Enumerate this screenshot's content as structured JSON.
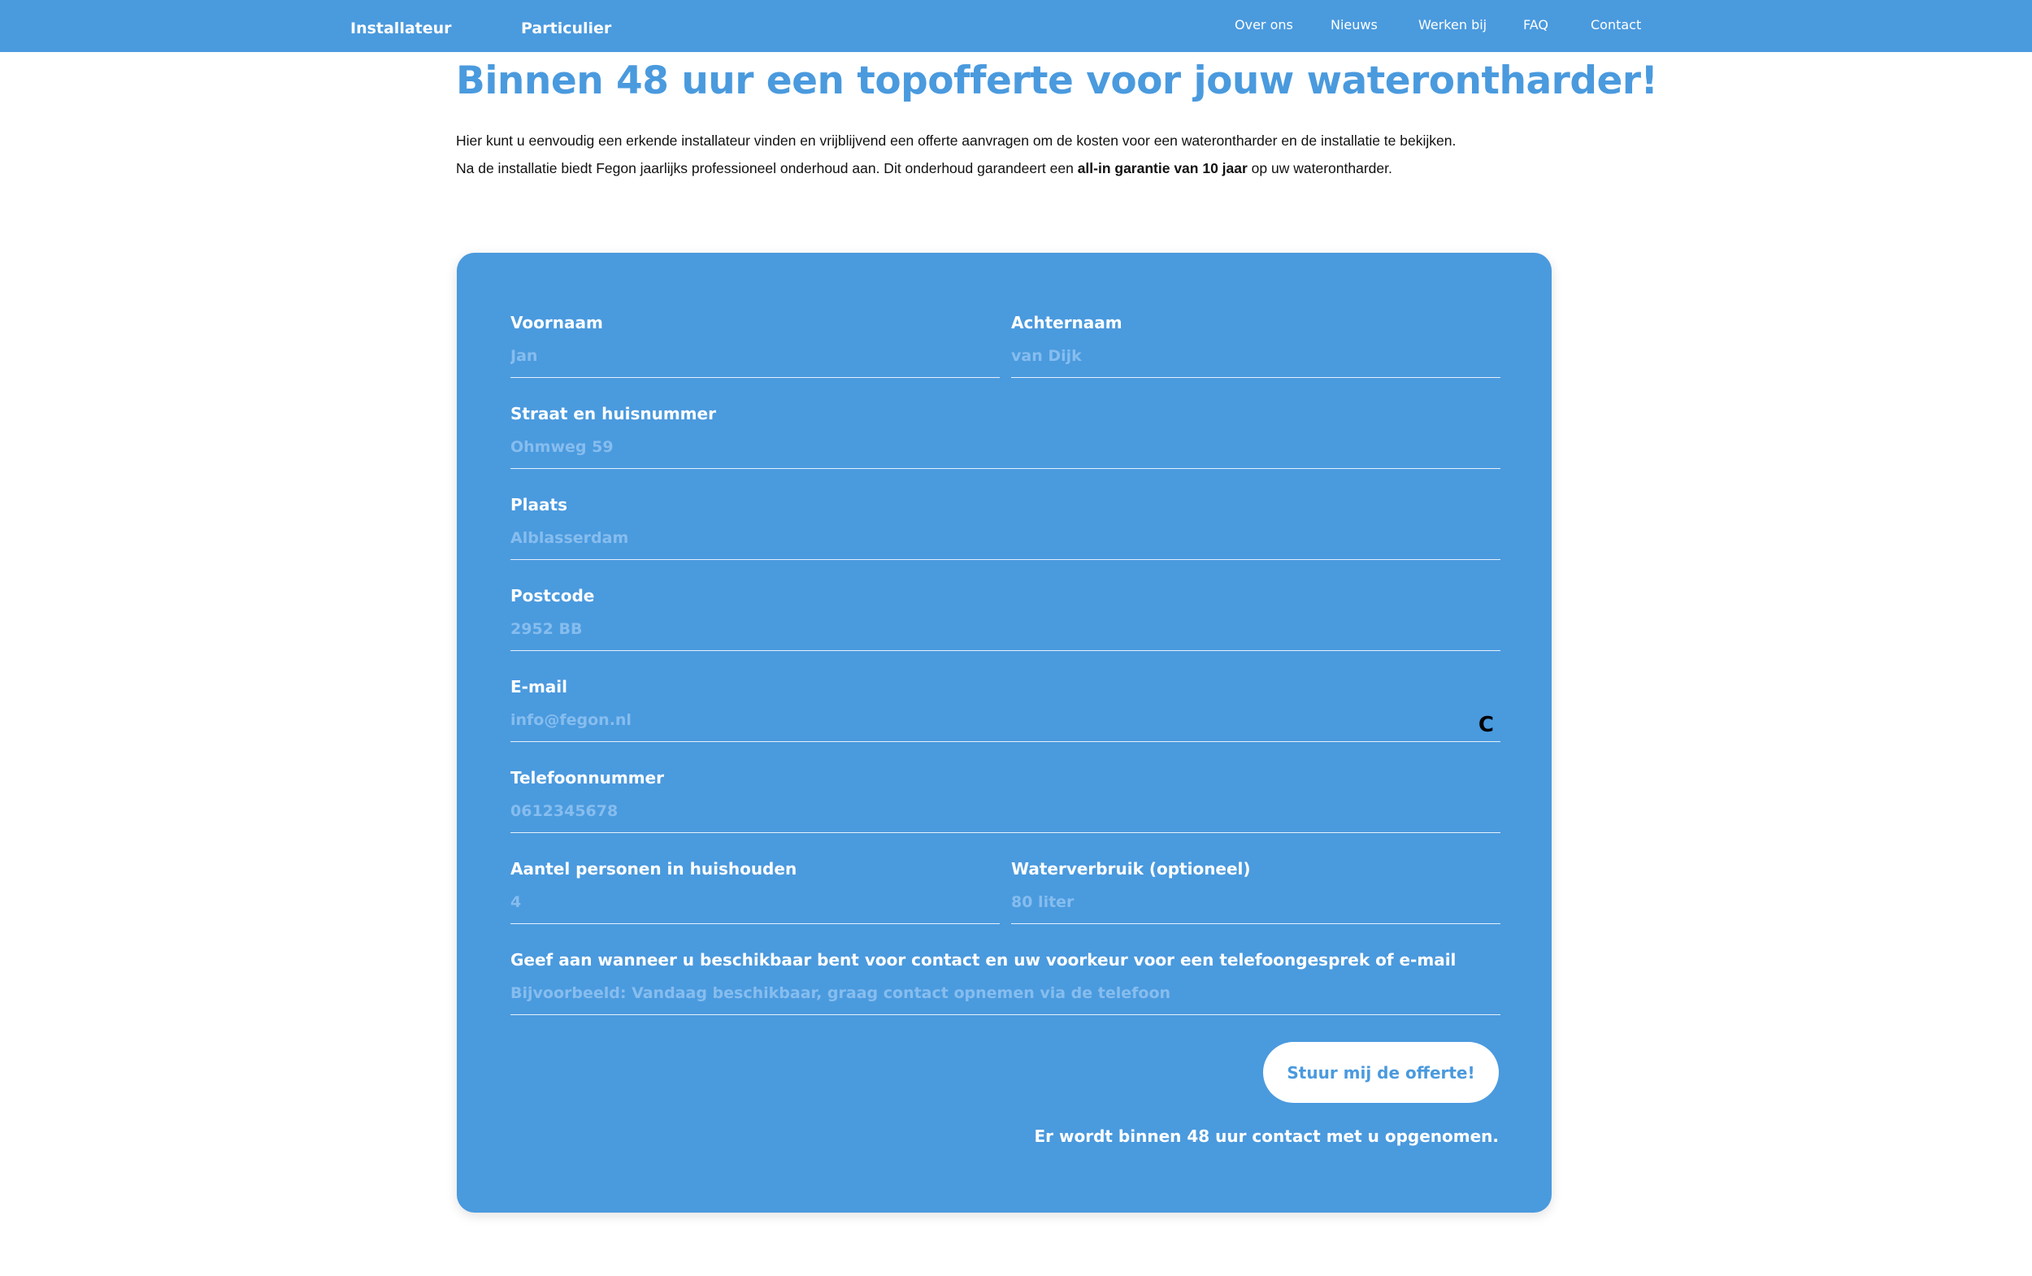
{
  "nav": {
    "left": [
      "Installateur",
      "Particulier"
    ],
    "right": [
      "Over ons",
      "Nieuws",
      "Werken bij",
      "FAQ",
      "Contact"
    ]
  },
  "hero": {
    "title": "Binnen 48 uur een topofferte voor jouw waterontharder!",
    "line1": "Hier kunt u eenvoudig een erkende installateur vinden en vrijblijvend een offerte aanvragen om de kosten voor een waterontharder en de installatie te bekijken.",
    "line2_before": "Na de installatie biedt Fegon jaarlijks professioneel onderhoud aan. Dit onderhoud garandeert een ",
    "line2_bold": "all-in garantie van 10 jaar",
    "line2_after": " op uw waterontharder."
  },
  "form": {
    "voornaam": {
      "label": "Voornaam",
      "placeholder": "Jan"
    },
    "achternaam": {
      "label": "Achternaam",
      "placeholder": "van Dijk"
    },
    "straat": {
      "label": "Straat en huisnummer",
      "placeholder": "Ohmweg 59"
    },
    "plaats": {
      "label": "Plaats",
      "placeholder": "Alblasserdam"
    },
    "postcode": {
      "label": "Postcode",
      "placeholder": "2952 BB"
    },
    "email": {
      "label": "E-mail",
      "placeholder": "info@fegon.nl",
      "loader_glyph": "C"
    },
    "telefoon": {
      "label": "Telefoonnummer",
      "placeholder": "0612345678"
    },
    "personen": {
      "label": "Aantel personen in huishouden",
      "placeholder": "4"
    },
    "waterverbruik": {
      "label": "Waterverbruik (optioneel)",
      "placeholder": "80 liter"
    },
    "beschikbaar": {
      "label": "Geef aan wanneer u beschikbaar bent voor contact en uw voorkeur voor een telefoongesprek of e-mail",
      "placeholder": "Bijvoorbeeld: Vandaag beschikbaar, graag contact opnemen via de telefoon"
    },
    "submit_label": "Stuur mij de offerte!",
    "notice": "Er wordt binnen 48 uur contact met u opgenomen."
  },
  "colors": {
    "brand": "#4a9ade",
    "placeholder": "#86bdee",
    "white": "#ffffff"
  }
}
